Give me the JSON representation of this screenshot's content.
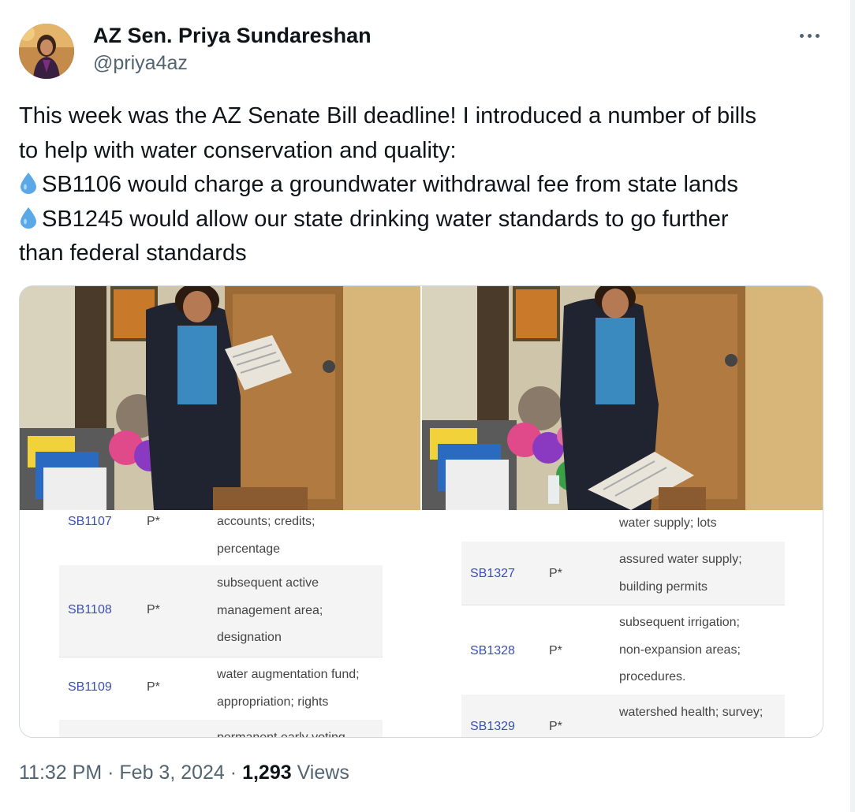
{
  "author": {
    "display_name": "AZ Sen. Priya Sundareshan",
    "handle": "@priya4az"
  },
  "tweet": {
    "lines": [
      "This week was the AZ Senate Bill deadline! I introduced a number of bills",
      "to help with water conservation and quality:",
      "SB1106 would charge a groundwater withdrawal fee from state lands",
      "SB1245 would allow our state drinking water standards to go further",
      "than federal standards"
    ],
    "emoji_icon": "droplet-icon"
  },
  "media": {
    "left_doc_rows": [
      {
        "bill": "SB1107",
        "flag": "P*",
        "desc": [
          "accounts; credits;",
          "percentage"
        ]
      },
      {
        "bill": "SB1108",
        "flag": "P*",
        "desc": [
          "subsequent active",
          "management area;",
          "designation"
        ]
      },
      {
        "bill": "SB1109",
        "flag": "P*",
        "desc": [
          "water augmentation fund;",
          "appropriation; rights"
        ]
      },
      {
        "bill": "",
        "flag": "",
        "desc": [
          "permanent early voting"
        ]
      }
    ],
    "right_doc_rows": [
      {
        "bill": "",
        "flag": "",
        "desc": [
          "water supply; lots"
        ]
      },
      {
        "bill": "SB1327",
        "flag": "P*",
        "desc": [
          "assured water supply;",
          "building permits"
        ]
      },
      {
        "bill": "SB1328",
        "flag": "P*",
        "desc": [
          "subsequent irrigation;",
          "non-expansion areas;",
          "procedures."
        ]
      },
      {
        "bill": "SB1329",
        "flag": "P*",
        "desc": [
          "watershed health; survey;"
        ]
      }
    ]
  },
  "meta": {
    "time": "11:32 PM",
    "sep": "·",
    "date": "Feb 3, 2024",
    "views_count": "1,293",
    "views_label": "Views"
  },
  "colors": {
    "text": "#0f1419",
    "muted": "#536471",
    "link_blue": "#3a4fb5",
    "droplet": "#5aa9e6"
  }
}
